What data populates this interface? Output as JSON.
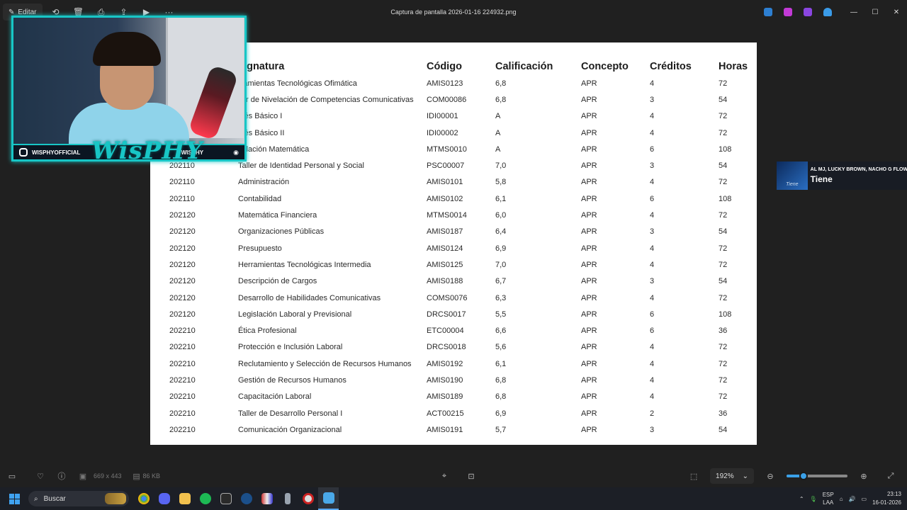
{
  "window": {
    "edit_label": "Editar",
    "title": "Captura de pantalla 2026-01-16 224932.png"
  },
  "document": {
    "headers": [
      "Asignatura",
      "Código",
      "Calificación",
      "Concepto",
      "Créditos",
      "Horas"
    ],
    "header_visible": [
      "signatura",
      "Código",
      "Calificación",
      "Concepto",
      "Créditos",
      "Horas"
    ],
    "rows": [
      {
        "period": "",
        "subject": "rramientas Tecnológicas Ofimática",
        "code": "AMIS0123",
        "grade": "6,8",
        "concept": "APR",
        "credits": "4",
        "hours": "72"
      },
      {
        "period": "",
        "subject": "ller de Nivelación de Competencias Comunicativas",
        "code": "COM00086",
        "grade": "6,8",
        "concept": "APR",
        "credits": "3",
        "hours": "54"
      },
      {
        "period": "",
        "subject": "glés Básico I",
        "code": "IDI00001",
        "grade": "A",
        "concept": "APR",
        "credits": "4",
        "hours": "72"
      },
      {
        "period": "",
        "subject": "glés Básico II",
        "code": "IDI00002",
        "grade": "A",
        "concept": "APR",
        "credits": "4",
        "hours": "72"
      },
      {
        "period": "",
        "subject": "velación Matemática",
        "code": "MTMS0010",
        "grade": "A",
        "concept": "APR",
        "credits": "6",
        "hours": "108"
      },
      {
        "period": "202110",
        "subject": "Taller de Identidad Personal y Social",
        "code": "PSC00007",
        "grade": "7,0",
        "concept": "APR",
        "credits": "3",
        "hours": "54"
      },
      {
        "period": "202110",
        "subject": "Administración",
        "code": "AMIS0101",
        "grade": "5,8",
        "concept": "APR",
        "credits": "4",
        "hours": "72"
      },
      {
        "period": "202110",
        "subject": "Contabilidad",
        "code": "AMIS0102",
        "grade": "6,1",
        "concept": "APR",
        "credits": "6",
        "hours": "108"
      },
      {
        "period": "202120",
        "subject": "Matemática Financiera",
        "code": "MTMS0014",
        "grade": "6,0",
        "concept": "APR",
        "credits": "4",
        "hours": "72"
      },
      {
        "period": "202120",
        "subject": "Organizaciones Públicas",
        "code": "AMIS0187",
        "grade": "6,4",
        "concept": "APR",
        "credits": "3",
        "hours": "54"
      },
      {
        "period": "202120",
        "subject": "Presupuesto",
        "code": "AMIS0124",
        "grade": "6,9",
        "concept": "APR",
        "credits": "4",
        "hours": "72"
      },
      {
        "period": "202120",
        "subject": "Herramientas Tecnológicas Intermedia",
        "code": "AMIS0125",
        "grade": "7,0",
        "concept": "APR",
        "credits": "4",
        "hours": "72"
      },
      {
        "period": "202120",
        "subject": "Descripción de Cargos",
        "code": "AMIS0188",
        "grade": "6,7",
        "concept": "APR",
        "credits": "3",
        "hours": "54"
      },
      {
        "period": "202120",
        "subject": "Desarrollo de Habilidades Comunicativas",
        "code": "COMS0076",
        "grade": "6,3",
        "concept": "APR",
        "credits": "4",
        "hours": "72"
      },
      {
        "period": "202120",
        "subject": "Legislación Laboral y Previsional",
        "code": "DRCS0017",
        "grade": "5,5",
        "concept": "APR",
        "credits": "6",
        "hours": "108"
      },
      {
        "period": "202210",
        "subject": "Ética Profesional",
        "code": "ETC00004",
        "grade": "6,6",
        "concept": "APR",
        "credits": "6",
        "hours": "36"
      },
      {
        "period": "202210",
        "subject": "Protección e Inclusión Laboral",
        "code": "DRCS0018",
        "grade": "5,6",
        "concept": "APR",
        "credits": "4",
        "hours": "72"
      },
      {
        "period": "202210",
        "subject": "Reclutamiento y Selección de Recursos Humanos",
        "code": "AMIS0192",
        "grade": "6,1",
        "concept": "APR",
        "credits": "4",
        "hours": "72"
      },
      {
        "period": "202210",
        "subject": "Gestión de Recursos Humanos",
        "code": "AMIS0190",
        "grade": "6,8",
        "concept": "APR",
        "credits": "4",
        "hours": "72"
      },
      {
        "period": "202210",
        "subject": "Capacitación Laboral",
        "code": "AMIS0189",
        "grade": "6,8",
        "concept": "APR",
        "credits": "4",
        "hours": "72"
      },
      {
        "period": "202210",
        "subject": "Taller de Desarrollo Personal I",
        "code": "ACT00215",
        "grade": "6,9",
        "concept": "APR",
        "credits": "2",
        "hours": "36"
      },
      {
        "period": "202210",
        "subject": "Comunicación Organizacional",
        "code": "AMIS0191",
        "grade": "5,7",
        "concept": "APR",
        "credits": "3",
        "hours": "54"
      }
    ]
  },
  "webcam": {
    "instagram_handle": "WISPHYOFFICIAL",
    "logo_text": "WisPHY",
    "discord_handle": "WISPHY"
  },
  "now_playing": {
    "artists": "AL MJ, LUCKY BROWN, NACHO G FLOW",
    "song": "Tiene",
    "cover_text": "Tiene"
  },
  "status": {
    "dimensions": "669 x 443",
    "file_size": "86 KB",
    "zoom": "192%",
    "zoom_level_fraction": 0.28
  },
  "taskbar": {
    "search_label": "Buscar",
    "language_top": "ESP",
    "language_bottom": "LAA",
    "time": "23:13",
    "date": "16-01-2026"
  },
  "colors": {
    "accent": "#18c6c6",
    "background": "#202020",
    "taskbar": "#1c1f26",
    "windows_blue": "#3fa2f0"
  }
}
